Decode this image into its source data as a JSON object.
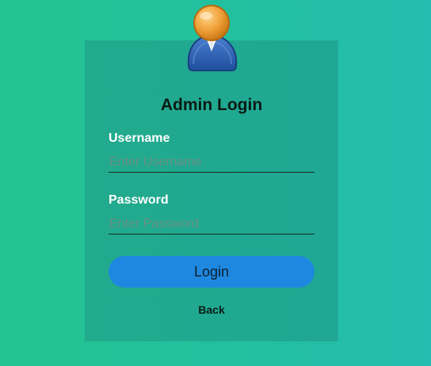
{
  "form": {
    "title": "Admin Login",
    "username_label": "Username",
    "username_placeholder": "Enter Username",
    "username_value": "",
    "password_label": "Password",
    "password_placeholder": "Enter Password",
    "password_value": "",
    "login_label": "Login",
    "back_label": "Back"
  },
  "icons": {
    "avatar": "user-avatar-icon"
  },
  "colors": {
    "background_start": "#23c490",
    "background_end": "#24bcae",
    "card": "#21aa8c",
    "button": "#1e88e0",
    "label": "#ffffff"
  }
}
